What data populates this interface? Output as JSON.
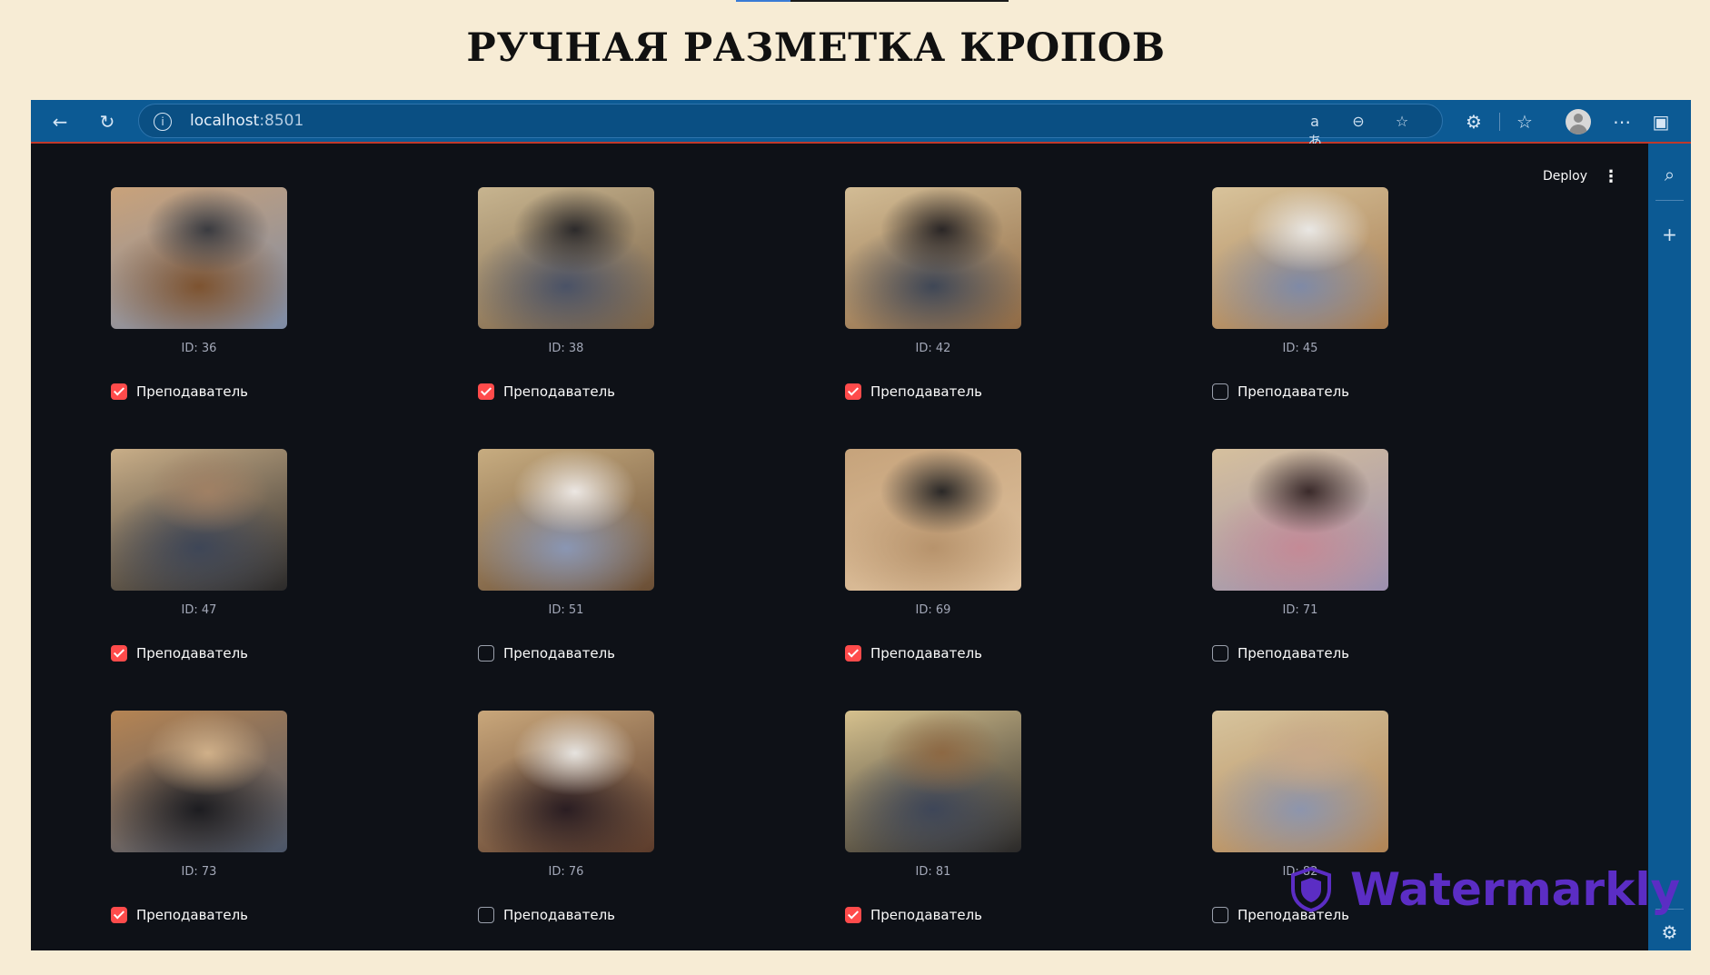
{
  "slide": {
    "title": "РУЧНАЯ РАЗМЕТКА КРОПОВ"
  },
  "browser": {
    "url_host": "localhost",
    "url_port": ":8501",
    "icons": [
      "back-icon",
      "refresh-icon",
      "info-icon",
      "translate-icon",
      "zoom-out-icon",
      "star-icon",
      "extensions-icon",
      "favorites-icon",
      "profile-icon",
      "more-icon",
      "sidebar-toggle-icon"
    ]
  },
  "app": {
    "deploy_label": "Deploy",
    "menu_label": "⋮",
    "cards": [
      {
        "id_label": "ID: 36",
        "checkbox_label": "Преподаватель",
        "checked": true,
        "palette": [
          "#c9a27a",
          "#7d5330",
          "#3a3b40",
          "#7e8ca6"
        ]
      },
      {
        "id_label": "ID: 38",
        "checkbox_label": "Преподаватель",
        "checked": true,
        "palette": [
          "#c7b48f",
          "#4a5266",
          "#2c2a2b",
          "#7a6247"
        ]
      },
      {
        "id_label": "ID: 42",
        "checkbox_label": "Преподаватель",
        "checked": true,
        "palette": [
          "#d2bc95",
          "#3f4756",
          "#2a2626",
          "#8f6a45"
        ]
      },
      {
        "id_label": "ID: 45",
        "checkbox_label": "Преподаватель",
        "checked": false,
        "palette": [
          "#d8c39b",
          "#7f8aa6",
          "#e9e7e4",
          "#a57a4f"
        ]
      },
      {
        "id_label": "ID: 47",
        "checkbox_label": "Преподаватель",
        "checked": true,
        "palette": [
          "#c9ae88",
          "#3e4657",
          "#a08064",
          "#2b2a2a"
        ]
      },
      {
        "id_label": "ID: 51",
        "checkbox_label": "Преподаватель",
        "checked": false,
        "palette": [
          "#c7ac80",
          "#8a96b3",
          "#ece7e3",
          "#6a4e35"
        ]
      },
      {
        "id_label": "ID: 69",
        "checkbox_label": "Преподаватель",
        "checked": true,
        "palette": [
          "#c6a37b",
          "#b7936c",
          "#2a2827",
          "#e0c3a0"
        ]
      },
      {
        "id_label": "ID: 71",
        "checkbox_label": "Преподаватель",
        "checked": false,
        "palette": [
          "#d6c09d",
          "#c48a96",
          "#3a2a2a",
          "#9c8fae"
        ]
      },
      {
        "id_label": "ID: 73",
        "checkbox_label": "Преподаватель",
        "checked": true,
        "palette": [
          "#b58453",
          "#1c1c20",
          "#d0b089",
          "#4a5568"
        ]
      },
      {
        "id_label": "ID: 76",
        "checkbox_label": "Преподаватель",
        "checked": false,
        "palette": [
          "#c9a77b",
          "#2a1d22",
          "#e6e3df",
          "#5b3b2b"
        ]
      },
      {
        "id_label": "ID: 81",
        "checkbox_label": "Преподаватель",
        "checked": true,
        "palette": [
          "#d6c18e",
          "#3e4658",
          "#8d6843",
          "#2a2929"
        ]
      },
      {
        "id_label": "ID: 82",
        "checkbox_label": "Преподаватель",
        "checked": false,
        "palette": [
          "#d7c49d",
          "#8d95ad",
          "#c7a88a",
          "#b08456"
        ]
      }
    ]
  },
  "watermark": {
    "text": "Watermarkly"
  },
  "colors": {
    "accent": "#ff4b4b",
    "browser_bar": "#0c5a94",
    "app_bg": "#0e1117",
    "slide_bg": "#f7ecd5",
    "watermark": "#5b2dc4"
  }
}
